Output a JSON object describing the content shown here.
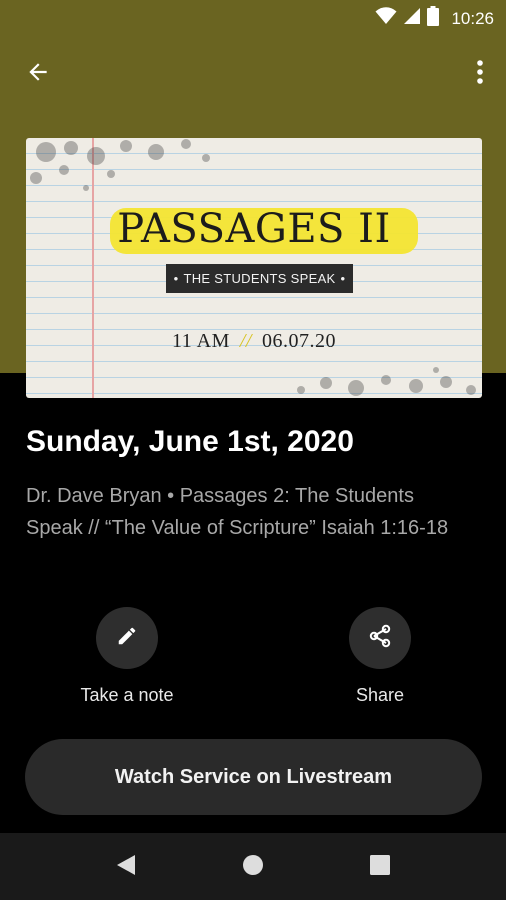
{
  "status_bar": {
    "time": "10:26",
    "icons": [
      "wifi-icon",
      "cell-signal-icon",
      "battery-icon"
    ]
  },
  "toolbar": {
    "back_icon": "arrow-left-icon",
    "menu_icon": "more-vert-icon"
  },
  "hero": {
    "title": "PASSAGES II",
    "tagline": "THE STUDENTS SPEAK",
    "time": "11 AM",
    "separator": "//",
    "date": "06.07.20"
  },
  "sermon": {
    "date_heading": "Sunday, June 1st, 2020",
    "description": "Dr. Dave Bryan • Passages 2: The Students Speak  //  “The Value of Scripture” Isaiah 1:16-18"
  },
  "actions": {
    "note": {
      "label": "Take a note",
      "icon": "pencil-icon"
    },
    "share": {
      "label": "Share",
      "icon": "share-icon"
    }
  },
  "watch_button": {
    "label": "Watch Service on Livestream"
  },
  "nav": {
    "icons": [
      "nav-back-icon",
      "nav-home-icon",
      "nav-recents-icon"
    ]
  },
  "colors": {
    "header_band": "#6a6421",
    "background": "#000000",
    "highlight": "#f3e531",
    "button_bg": "#2a2a2a"
  }
}
